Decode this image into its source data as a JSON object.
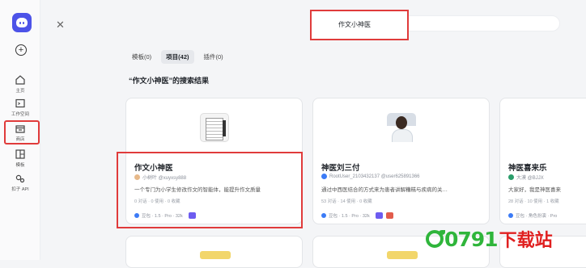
{
  "sidebar": {
    "items": [
      {
        "label": "主页",
        "icon": "home-icon"
      },
      {
        "label": "工作空间",
        "icon": "terminal-icon"
      },
      {
        "label": "商店",
        "icon": "store-icon"
      },
      {
        "label": "模板",
        "icon": "template-icon"
      },
      {
        "label": "扣子 API",
        "icon": "api-icon"
      }
    ]
  },
  "search": {
    "value": "作文小神医"
  },
  "tabs": [
    {
      "label": "模板(0)"
    },
    {
      "label": "项目(42)",
      "active": true
    },
    {
      "label": "插件(0)"
    }
  ],
  "results_title": "“作文小神医”的搜索结果",
  "cards": [
    {
      "name": "作文小神医",
      "author": "小树叶 @xuyxsy888",
      "desc": "一个专门为小学生修改作文的智能体，能提升作文质量",
      "stats": "0 对话 · 0 使用 · 0 收藏",
      "model": "豆包 · 1.5 · Pro · 32k"
    },
    {
      "name": "神医刘三付",
      "author": "RootUser_2103432137 @user625891366",
      "desc": "通过中西医结合的方式来为患者讲解糟糕与疾病的关…",
      "stats": "53 对话 · 14 使用 · 0 收藏",
      "model": "豆包 · 1.5 · Pro · 32k"
    },
    {
      "name": "神医喜来乐",
      "author": "大漠 @BJJX",
      "desc": "大家好，我是神医喜来",
      "stats": "28 对话 · 10 使用 · 1 收藏",
      "model": "豆包 · 角色扮演 · Pro"
    }
  ],
  "watermark": {
    "num": "0791",
    "cn": "下载站"
  },
  "colors": {
    "accent": "#4d53e8",
    "highlight": "#e03b3b",
    "watermark_green": "#2fb53b",
    "watermark_red": "#e02020"
  }
}
